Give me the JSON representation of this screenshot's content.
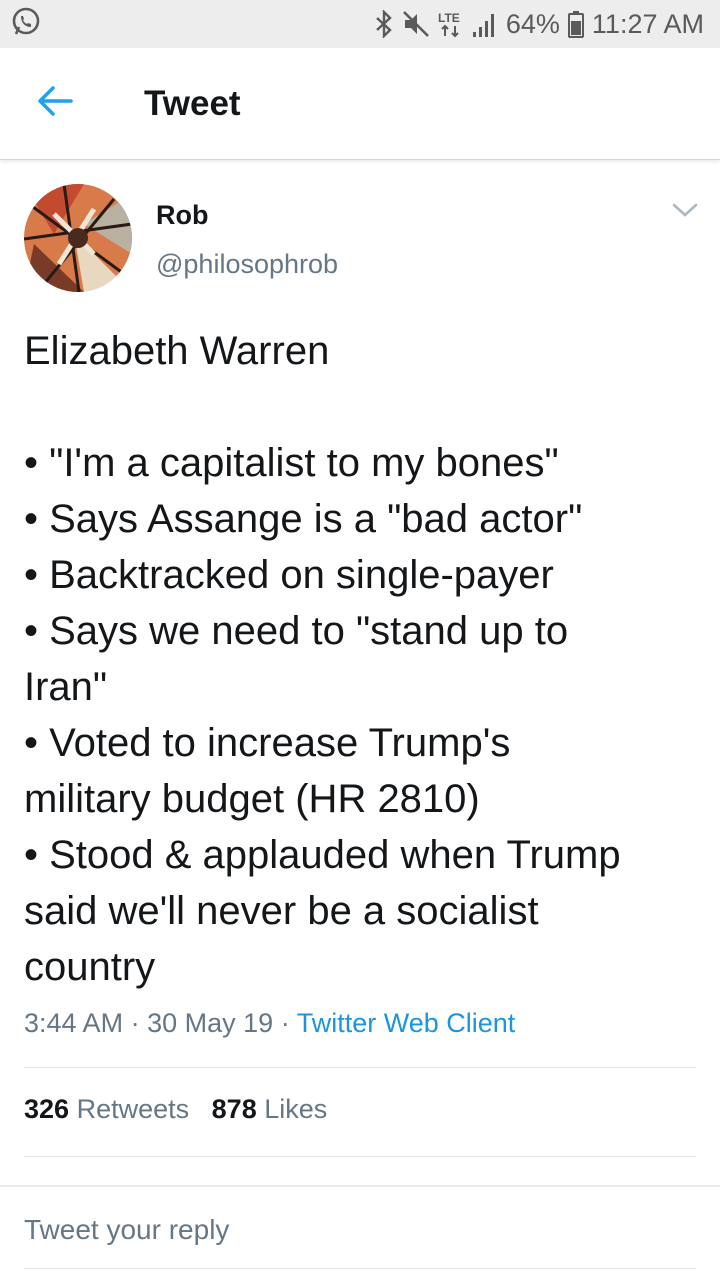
{
  "status_bar": {
    "battery": "64%",
    "time": "11:27 AM",
    "network": "LTE",
    "icons": [
      "whatsapp-icon",
      "bluetooth-icon",
      "mute-icon",
      "lte-icon",
      "signal-icon",
      "battery-icon"
    ]
  },
  "header": {
    "title": "Tweet",
    "back_icon": "back-arrow-icon"
  },
  "tweet": {
    "author_name": "Rob",
    "author_handle": "@philosophrob",
    "lines": [
      "Elizabeth Warren",
      "",
      "• \"I'm a capitalist to my bones\"",
      "• Says Assange is a \"bad actor\"",
      "• Backtracked on single-payer",
      "• Says we need to \"stand up to",
      "Iran\"",
      "• Voted to increase Trump's",
      "military budget (HR 2810)",
      "• Stood & applauded when Trump",
      "said we'll never be a socialist",
      "country"
    ],
    "time": "3:44 AM",
    "date": "30 May 19",
    "separator": "·",
    "client": "Twitter Web Client",
    "retweets_count": "326",
    "retweets_label": "Retweets",
    "likes_count": "878",
    "likes_label": "Likes"
  },
  "reply": {
    "placeholder": "Tweet your reply"
  },
  "colors": {
    "link": "#1b95e0",
    "secondary_text": "#657786",
    "primary_text": "#14171a"
  }
}
